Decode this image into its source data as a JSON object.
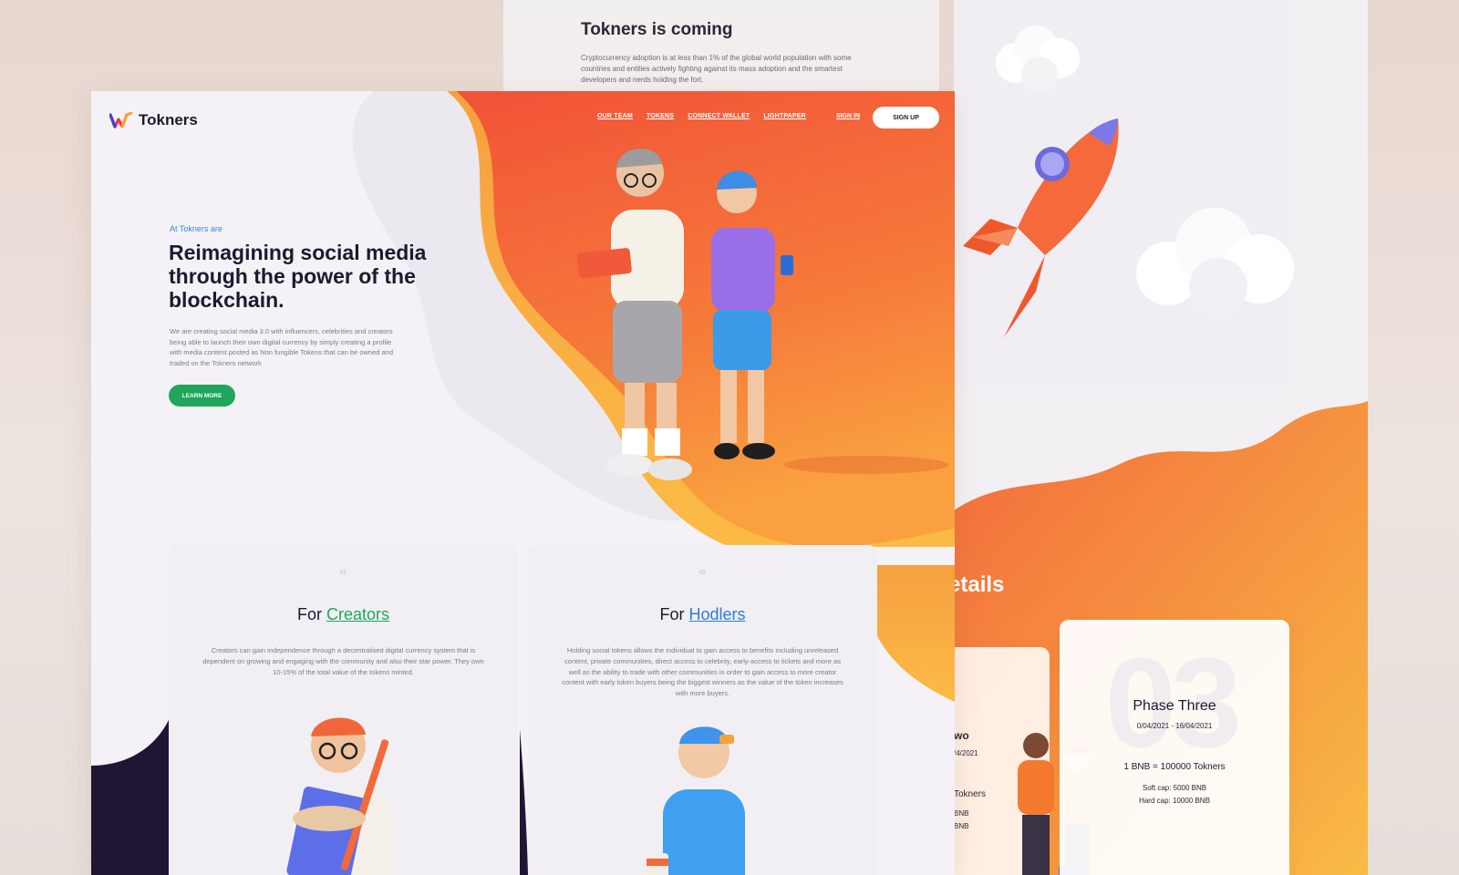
{
  "colors": {
    "accent_orange": "#f15a3a",
    "accent_yellow": "#f8b545",
    "green": "#1fa65a",
    "blue": "#2f7bd6",
    "dark": "#1c1a2e"
  },
  "top_artboard": {
    "title": "Tokners is coming",
    "text": "Cryptocurrency adoption is at less than 1% of the global world population with some countries and entities actively fighting against its mass adoption and the smartest developers and nerds holding the fort."
  },
  "right_artboard": {
    "section_title_partial": "etails",
    "phase_two": {
      "title_partial": "wo",
      "date_partial": "/4/2021",
      "rate_partial": "Tokners",
      "soft_partial": "BNB",
      "hard_partial": "BNB"
    },
    "phase_three": {
      "number": "03",
      "title": "Phase Three",
      "date": "0/04/2021 - 16/04/2021",
      "rate": "1 BNB = 100000 Tokners",
      "soft_cap": "Soft cap: 5000 BNB",
      "hard_cap": "Hard cap: 10000 BNB"
    }
  },
  "header": {
    "logo_text": "Tokners",
    "nav": [
      "OUR TEAM",
      "TOKENS",
      "CONNECT WALLET",
      "LIGHTPAPER"
    ],
    "sign_in": "SIGN IN",
    "sign_up": "SIGN UP"
  },
  "hero": {
    "eyebrow": "At Tokners are",
    "title": "Reimagining social media through the power of the blockchain.",
    "description": "We are creating social media 3.0 with influencers, celebrities and creators being able to launch their own digital currency by simply creating a profile with media content posted as Non fungible Tokens that can be owned and traded on the Tokners network",
    "cta": "LEARN MORE"
  },
  "cards": [
    {
      "number": "01",
      "title_prefix": "For",
      "title_highlight": "Creators",
      "description": "Creators can gain independence through a decentralised digital currency system that is dependent on growing and engaging with the community and also their star power. They own 10-15% of the total value of the tokens minted."
    },
    {
      "number": "02",
      "title_prefix": "For",
      "title_highlight": "Hodlers",
      "description": "Holding social tokens allows the individual to gain access to benefits including unreleased content, private communities, direct access to celebrity, early-access to tickets and more as well as the ability to trade with other communities in order to gain access to more creator content with early token buyers being the biggest winners as the value of the token increases with more buyers."
    }
  ]
}
